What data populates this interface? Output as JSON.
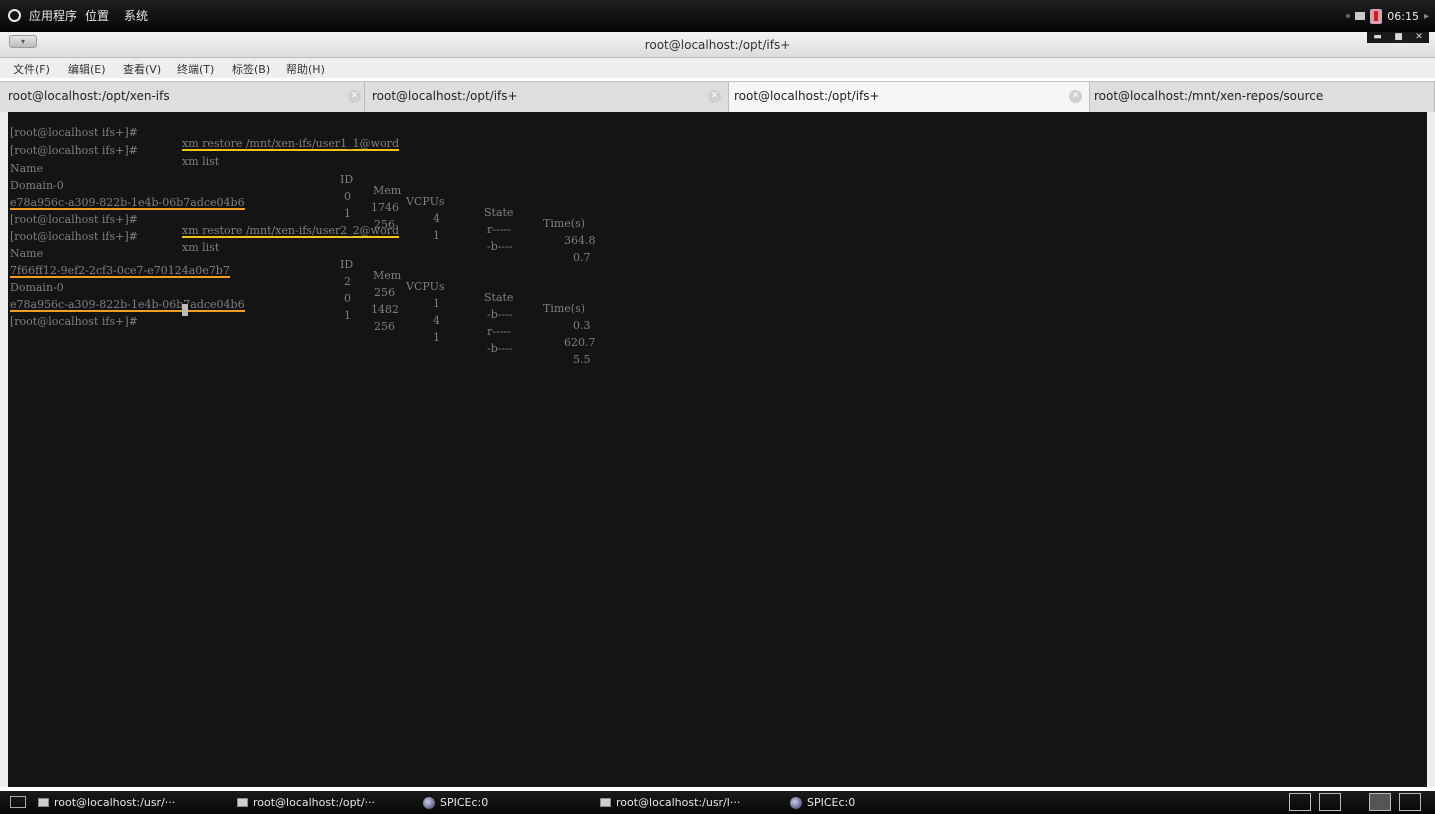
{
  "top_panel": {
    "applications": "应用程序",
    "places": "位置",
    "system": "系统",
    "clock": "06:15"
  },
  "window": {
    "title": "root@localhost:/opt/ifs+"
  },
  "menubar": {
    "file": "文件(F)",
    "edit": "编辑(E)",
    "view": "查看(V)",
    "terminal": "终端(T)",
    "tabs": "标签(B)",
    "help": "帮助(H)"
  },
  "tabs": [
    {
      "label": "root@localhost:/opt/xen-ifs"
    },
    {
      "label": "root@localhost:/opt/ifs+"
    },
    {
      "label": "root@localhost:/opt/ifs+"
    },
    {
      "label": "root@localhost:/mnt/xen-repos/source"
    }
  ],
  "terminal": {
    "prompt": "[root@localhost ifs+]# ",
    "cmd1": "xm restore /mnt/xen-ifs/user1_1@word",
    "cmd2": "xm list",
    "cmd3": "xm restore /mnt/xen-ifs/user2_2@word",
    "cmd4": "xm list",
    "headers": {
      "name": "Name",
      "id": "ID",
      "mem": "Mem",
      "vcpus": "VCPUs",
      "state": "State",
      "time": "Time(s)"
    },
    "list1": [
      {
        "name": "Domain-0",
        "id": "0",
        "mem": "1746",
        "vcpus": "4",
        "state": "r-----",
        "time": "364.8"
      },
      {
        "name": "e78a956c-a309-822b-1e4b-06b7adce04b6",
        "id": "1",
        "mem": "256",
        "vcpus": "1",
        "state": "-b----",
        "time": "0.7"
      }
    ],
    "list2": [
      {
        "name": "7f66ff12-9ef2-2cf3-0ce7-e70124a0e7b7",
        "id": "2",
        "mem": "256",
        "vcpus": "1",
        "state": "-b----",
        "time": "0.3"
      },
      {
        "name": "Domain-0",
        "id": "0",
        "mem": "1482",
        "vcpus": "4",
        "state": "r-----",
        "time": "620.7"
      },
      {
        "name": "e78a956c-a309-822b-1e4b-06b7adce04b6",
        "id": "1",
        "mem": "256",
        "vcpus": "1",
        "state": "-b----",
        "time": "5.5"
      }
    ]
  },
  "taskbar": [
    {
      "label": "root@localhost:/usr/···"
    },
    {
      "label": "root@localhost:/opt/···"
    },
    {
      "label": "SPICEc:0"
    },
    {
      "label": "root@localhost:/usr/l···"
    },
    {
      "label": "SPICEc:0"
    }
  ]
}
